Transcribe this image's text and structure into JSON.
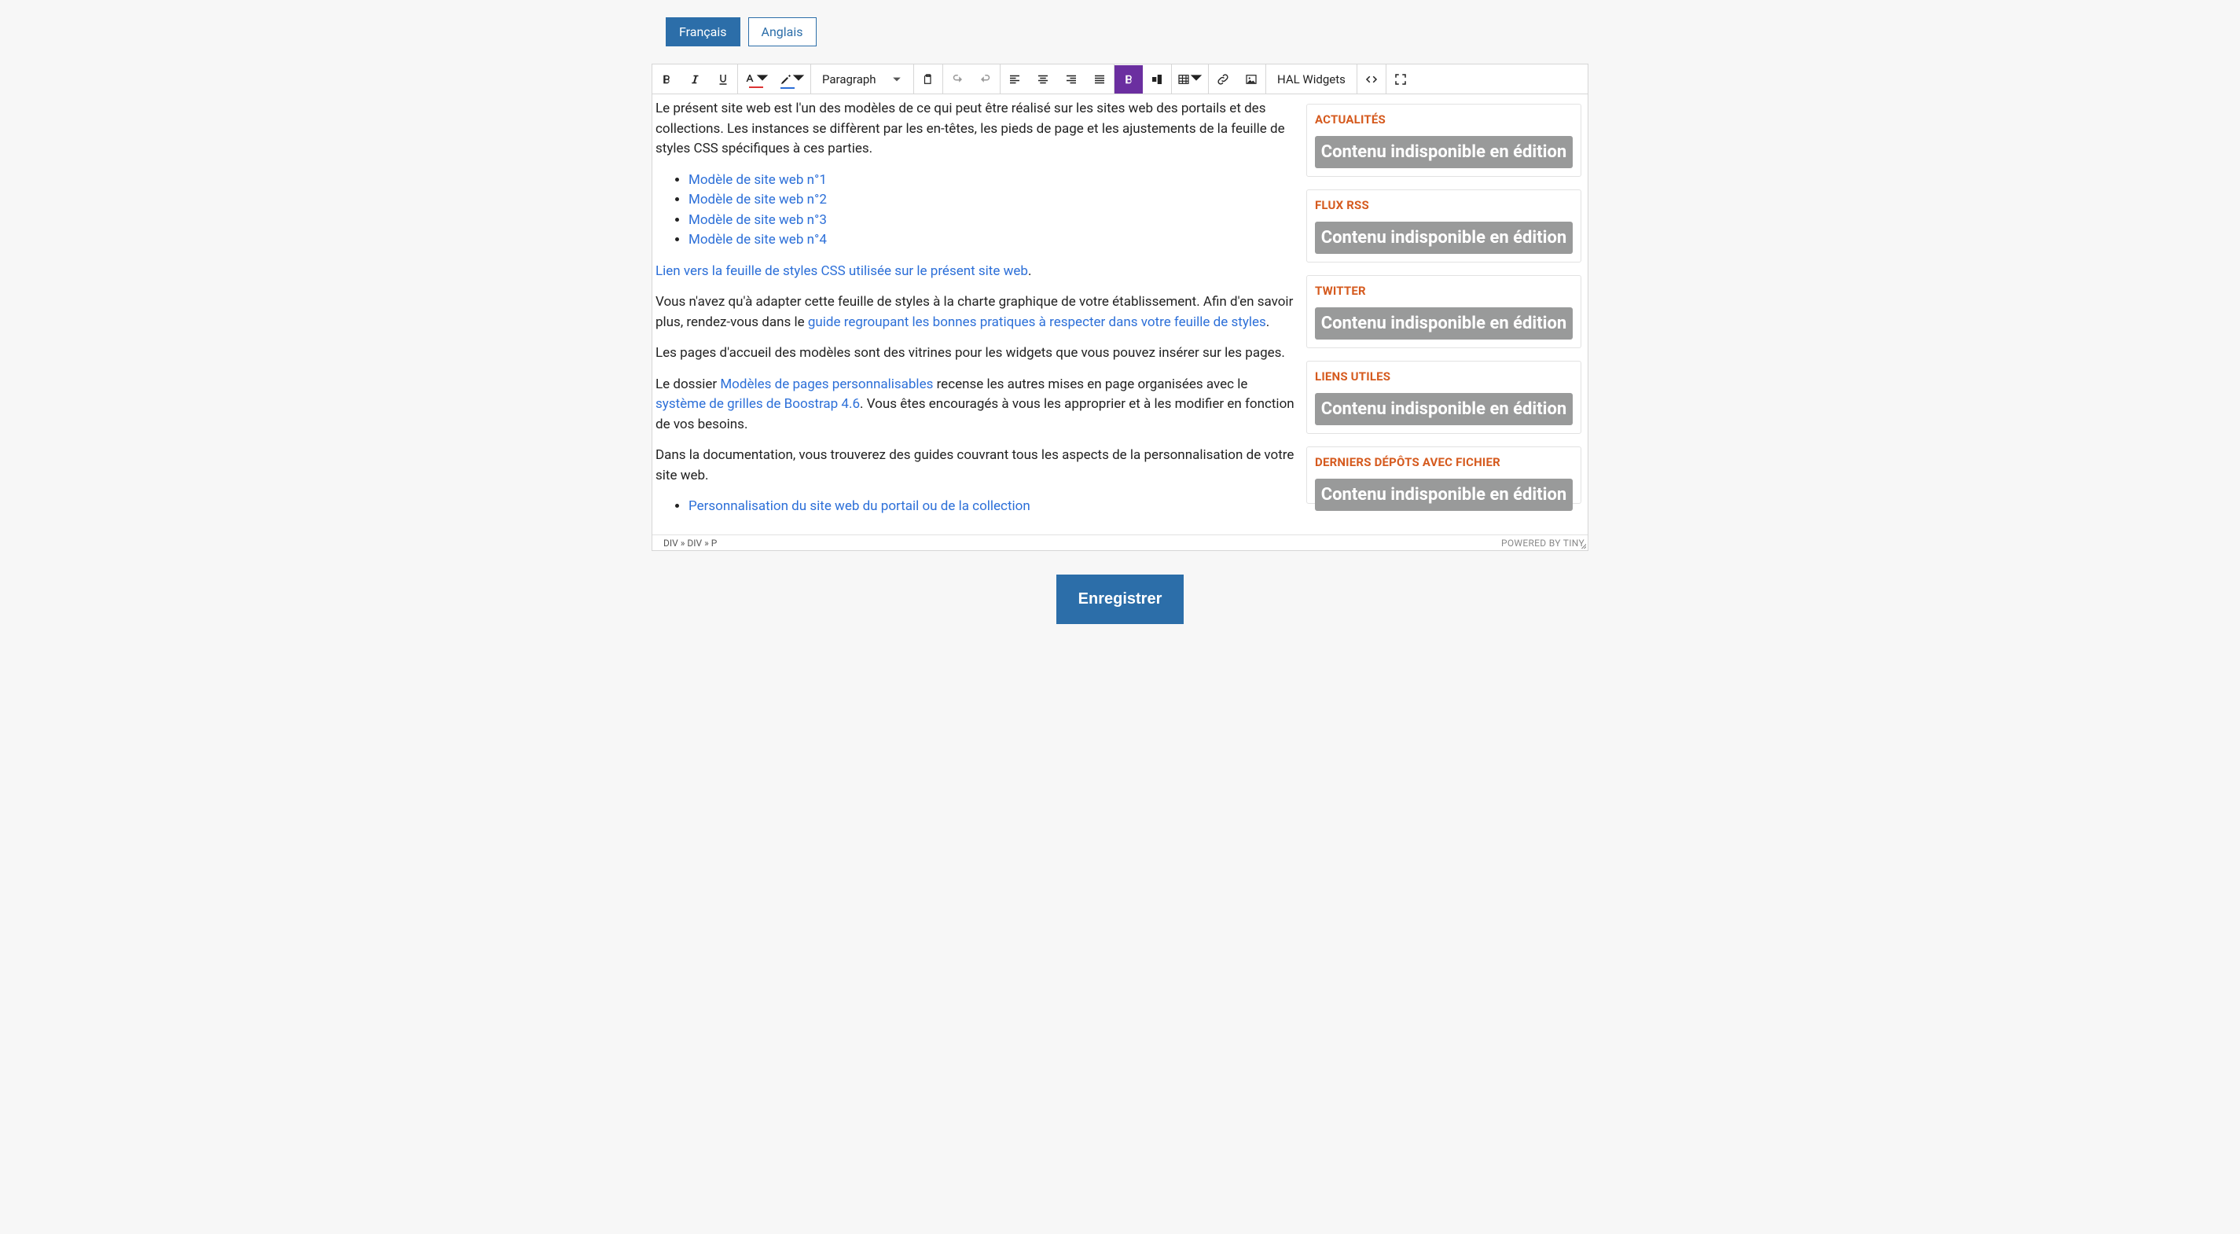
{
  "lang_tabs": {
    "fr": "Français",
    "en": "Anglais"
  },
  "toolbar": {
    "block_format": "Paragraph",
    "hal_widgets": "HAL Widgets"
  },
  "content": {
    "intro": "Le présent site web est l'un des modèles de ce qui peut être réalisé sur les sites web des portails et des collections. Les instances se diffèrent par les en-têtes, les pieds de page et les ajustements de la feuille de styles CSS spécifiques à ces parties.",
    "models": [
      "Modèle de site web n°1",
      "Modèle de site web n°2",
      "Modèle de site web n°3",
      "Modèle de site web n°4"
    ],
    "css_link": "Lien vers la feuille de styles CSS utilisée sur le présent site web",
    "css_link_after": ".",
    "adapt_before": "Vous n'avez qu'à adapter cette feuille de styles à la charte graphique de votre établissement. Afin d'en savoir plus, rendez-vous dans le ",
    "adapt_link": "guide regroupant les bonnes pratiques à respecter dans votre feuille de styles",
    "adapt_after": ".",
    "showcase": "Les pages d'accueil des modèles sont des vitrines pour les widgets que vous pouvez insérer sur les pages.",
    "folder_before": "Le dossier ",
    "folder_link1": "Modèles de pages personnalisables",
    "folder_mid": " recense les autres mises en page organisées avec le ",
    "folder_link2": "système de grilles de Boostrap 4.6",
    "folder_after": ". Vous êtes encouragés à vous les approprier et à les modifier en fonction de vos besoins.",
    "docs_intro": "Dans la documentation, vous trouverez des guides couvrant tous les aspects de la personnalisation de votre site web.",
    "docs_link1": "Personnalisation du site web du portail ou de la collection"
  },
  "widgets": {
    "unavailable": "Contenu indisponible en édition",
    "titles": {
      "news": "ACTUALITÉS",
      "rss": "FLUX RSS",
      "twitter": "TWITTER",
      "links": "LIENS UTILES",
      "recent": "DERNIERS DÉPÔTS AVEC FICHIER"
    }
  },
  "statusbar": {
    "path": "DIV » DIV » P",
    "powered": "POWERED BY TINY"
  },
  "buttons": {
    "save": "Enregistrer"
  }
}
